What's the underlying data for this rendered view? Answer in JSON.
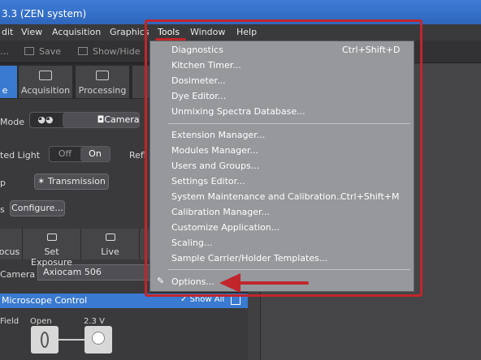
{
  "window": {
    "title": "3.3 (ZEN system)"
  },
  "menubar": {
    "items": [
      "dit",
      "View",
      "Acquisition",
      "Graphics",
      "Tools",
      "Window",
      "Help"
    ]
  },
  "toolbar": {
    "save_label": "Save",
    "show_hide_label": "Show/Hide"
  },
  "tabs": [
    {
      "label": "e",
      "active": true
    },
    {
      "label": "Acquisition"
    },
    {
      "label": "Processing"
    }
  ],
  "panel": {
    "mode_label": "Mode",
    "camera_button": "Camera",
    "transmitted_light_label": "ted Light",
    "toggle_off": "Off",
    "toggle_on": "On",
    "reflected_label": "Refl",
    "p_label": "p",
    "transmission_button": "Transmission",
    "configure_button": "Configure...",
    "acq_buttons": [
      "ocus",
      "Set Exposure",
      "Live"
    ],
    "camera_label": "Camera",
    "camera_value": "Axiocam 506"
  },
  "micro": {
    "title": "Microscope Control",
    "show_all": "Show All",
    "field_label": "Field",
    "open_label": "Open",
    "voltage_label": "2.3 V"
  },
  "dropdown": {
    "group1": [
      {
        "label": "Diagnostics",
        "shortcut": "Ctrl+Shift+D"
      },
      {
        "label": "Kitchen Timer..."
      },
      {
        "label": "Dosimeter..."
      },
      {
        "label": "Dye Editor..."
      },
      {
        "label": "Unmixing Spectra Database..."
      }
    ],
    "group2": [
      {
        "label": "Extension Manager..."
      },
      {
        "label": "Modules Manager..."
      },
      {
        "label": "Users and Groups..."
      },
      {
        "label": "Settings Editor..."
      },
      {
        "label": "System Maintenance and Calibration...",
        "shortcut": "Ctrl+Shift+M"
      },
      {
        "label": "Calibration Manager..."
      },
      {
        "label": "Customize Application..."
      },
      {
        "label": "Scaling..."
      },
      {
        "label": "Sample Carrier/Holder Templates..."
      }
    ],
    "group3": [
      {
        "label": "Options..."
      }
    ]
  },
  "colors": {
    "highlight": "#c0262c",
    "accent": "#3a7ad0"
  }
}
